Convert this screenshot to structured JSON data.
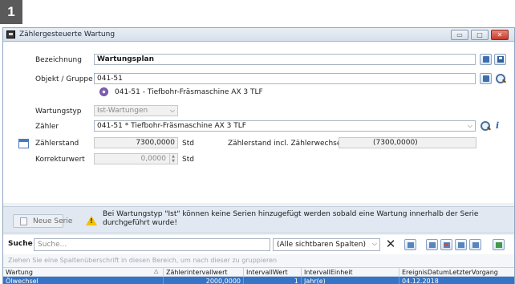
{
  "badge": "1",
  "window": {
    "title": "Zählergesteuerte Wartung",
    "controls": {
      "minimize": "▭",
      "maximize": "□",
      "close": "✕"
    }
  },
  "form": {
    "bezeichnung": {
      "label": "Bezeichnung",
      "value": "Wartungsplan"
    },
    "objekt": {
      "label": "Objekt / Gruppe",
      "value": "041-51",
      "resolved": "041-51 - Tiefbohr-Fräsmaschine AX 3 TLF"
    },
    "wartungstyp": {
      "label": "Wartungstyp",
      "value": "Ist-Wartungen"
    },
    "zaehler": {
      "label": "Zähler",
      "value": "041-51 * Tiefbohr-Fräsmaschine AX 3 TLF"
    },
    "zaehlerstand": {
      "label": "Zählerstand",
      "value": "7300,0000",
      "unit": "Std",
      "incl_label": "Zählerstand incl. Zählerwechsel:",
      "incl_value": "(7300,0000)"
    },
    "korrekturwert": {
      "label": "Korrekturwert",
      "value": "0,0000",
      "unit": "Std"
    }
  },
  "infobar": {
    "new_series_label": "Neue Serie",
    "warning": "Bei Wartungstyp \"Ist\" können keine Serien hinzugefügt werden sobald eine Wartung innerhalb der Serie durchgeführt wurde!"
  },
  "search": {
    "label": "Suche",
    "placeholder": "Suche...",
    "scope": "(Alle sichtbaren Spalten)",
    "clear_icon": "✕"
  },
  "group_hint": "Ziehen Sie eine Spaltenüberschrift in diesen Bereich, um nach dieser zu gruppieren",
  "grid": {
    "columns": [
      "Wartung",
      "Zählerintervallwert",
      "IntervallWert",
      "IntervallEinheit",
      "EreignisDatumLetzterVorgang"
    ],
    "rows": [
      [
        "Ölwechsel",
        "2000,0000",
        "1",
        "Jahr(e)",
        "04.12.2018"
      ]
    ]
  },
  "colors": {
    "selection": "#3574c6",
    "titlebar": "#d6dfea",
    "warning": "#f2c200"
  }
}
